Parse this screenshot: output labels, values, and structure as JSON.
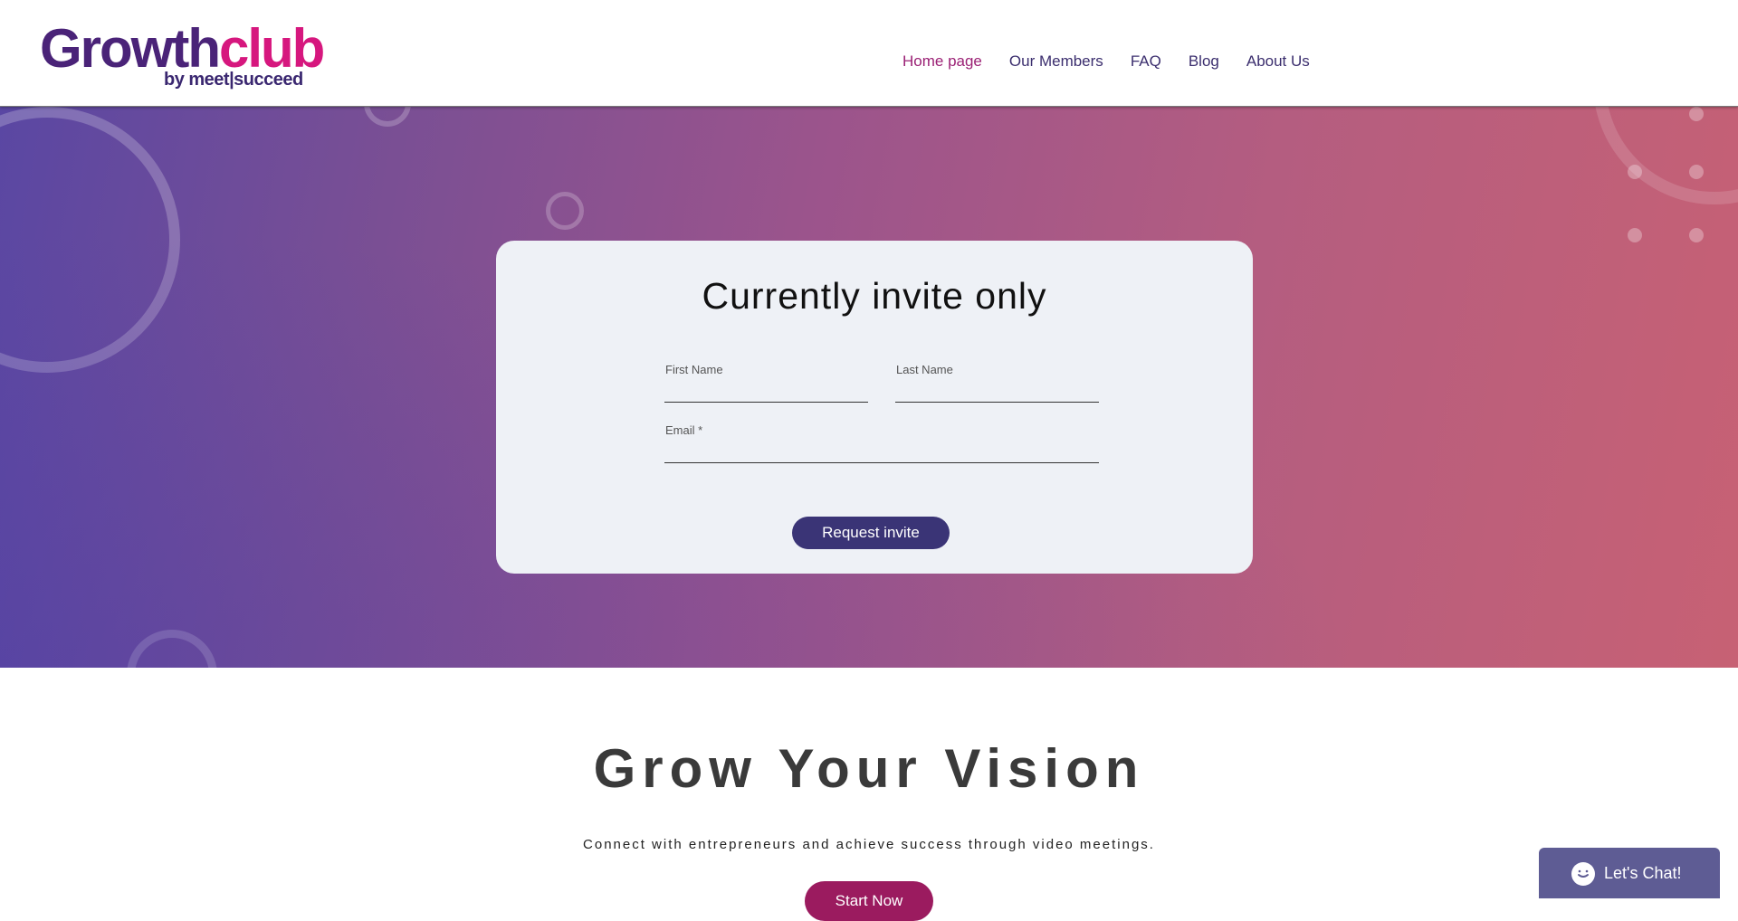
{
  "brand": {
    "logo_main_a": "Growth",
    "logo_main_b": "club",
    "logo_sub": "by meet|succeed",
    "colors": {
      "purple": "#4a2378",
      "pink": "#d6177e",
      "nav": "#3b2e6e",
      "nav_active": "#9b2175"
    }
  },
  "nav": {
    "items": [
      {
        "label": "Home page",
        "active": true
      },
      {
        "label": "Our Members",
        "active": false
      },
      {
        "label": "FAQ",
        "active": false
      },
      {
        "label": "Blog",
        "active": false
      },
      {
        "label": "About Us",
        "active": false
      }
    ]
  },
  "form": {
    "title": "Currently invite only",
    "first_name_label": "First Name",
    "last_name_label": "Last Name",
    "email_label": "Email *",
    "submit_label": "Request invite",
    "button_color": "#3a3476"
  },
  "vision": {
    "title": "Grow Your Vision",
    "subtitle": "Connect with entrepreneurs and achieve success through video meetings.",
    "cta_label": "Start Now"
  },
  "chat": {
    "label": "Let's Chat!",
    "icon": "chat-bubble-icon"
  }
}
